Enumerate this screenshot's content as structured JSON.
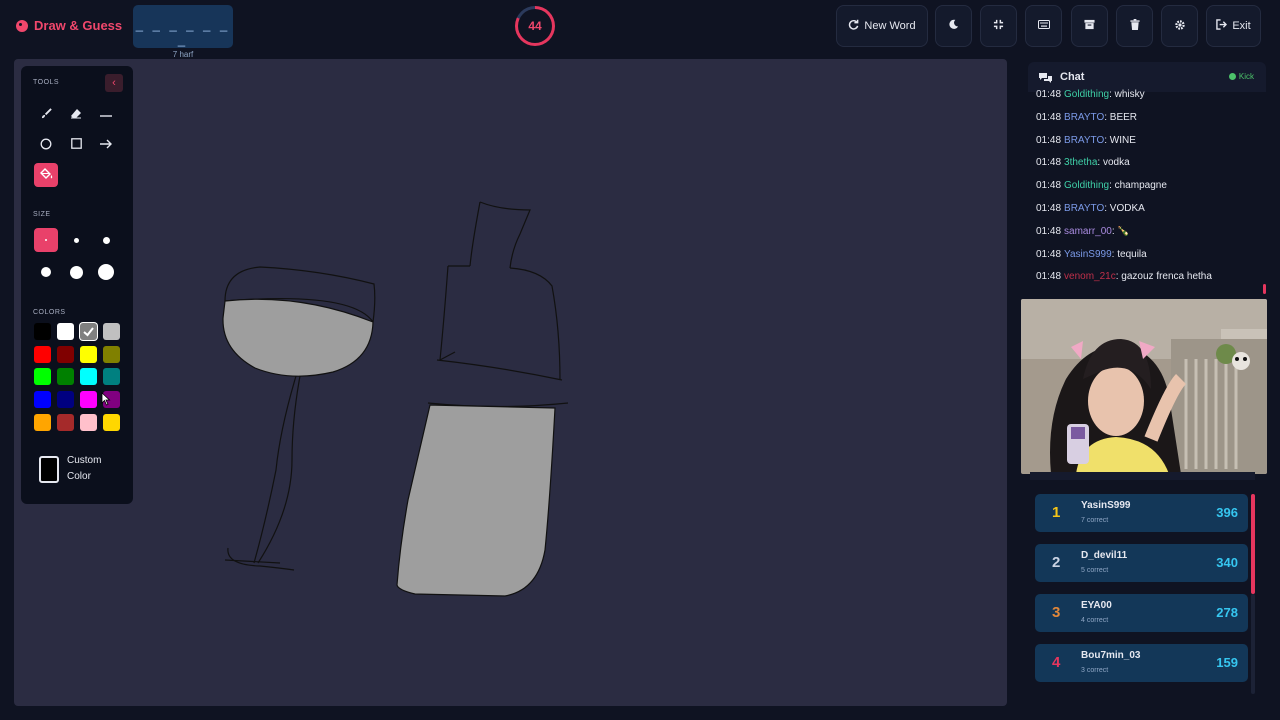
{
  "app": {
    "title": "Draw & Guess"
  },
  "word": {
    "dashes": "_ _ _ _ _ _ _",
    "hint": "7 harf"
  },
  "timer": {
    "seconds": "44",
    "progress": 0.82
  },
  "toolbar": {
    "new_word": "New Word",
    "exit": "Exit",
    "buttons": [
      "theme",
      "fullscreen",
      "keyboard",
      "archive",
      "clear",
      "settings"
    ]
  },
  "tools": {
    "title": "TOOLS",
    "items": [
      "brush",
      "eraser",
      "line",
      "circle",
      "rectangle",
      "arrow",
      "fill"
    ],
    "active": "fill",
    "size_label": "SIZE",
    "sizes": [
      2,
      4,
      6,
      8,
      10,
      12
    ],
    "active_size": 0,
    "colors_label": "COLORS",
    "colors": [
      "#000000",
      "#ffffff",
      "#808080",
      "#c0c0c0",
      "#ff0000",
      "#800000",
      "#ffff00",
      "#808000",
      "#00ff00",
      "#008000",
      "#00ffff",
      "#008080",
      "#0000ff",
      "#000080",
      "#ff00ff",
      "#800080",
      "#ffa500",
      "#a52a2a",
      "#ffc0cb",
      "#ffd700"
    ],
    "selected_color": "#808080",
    "custom_color": "Custom Color"
  },
  "canvas_actions": [
    "undo",
    "redo",
    "delete"
  ],
  "chat": {
    "title": "Chat",
    "status": "Kick",
    "messages": [
      {
        "time": "01:48",
        "user": "Goldithing",
        "text": ": whisky",
        "color": "#3fd0a8"
      },
      {
        "time": "01:48",
        "user": "BRAYTO",
        "text": ": BEER",
        "color": "#7b9ae8"
      },
      {
        "time": "01:48",
        "user": "BRAYTO",
        "text": ": WINE",
        "color": "#7b9ae8"
      },
      {
        "time": "01:48",
        "user": "3thetha",
        "text": ": vodka",
        "color": "#3fd0a8"
      },
      {
        "time": "01:48",
        "user": "Goldithing",
        "text": ": champagne",
        "color": "#3fd0a8"
      },
      {
        "time": "01:48",
        "user": "BRAYTO",
        "text": ": VODKA",
        "color": "#7b9ae8"
      },
      {
        "time": "01:48",
        "user": "samarr_00",
        "text": ": 🍾",
        "color": "#a98be0"
      },
      {
        "time": "01:48",
        "user": "YasinS999",
        "text": ": tequila",
        "color": "#7b9ae8"
      },
      {
        "time": "01:48",
        "user": "venom_21c",
        "text": ": gazouz frenca hetha",
        "color": "#c0304a"
      }
    ]
  },
  "leaderboard": {
    "rows": [
      {
        "rank": "1",
        "name": "YasinS999",
        "sub": "7 correct",
        "score": "396",
        "rank_color": "#f5c518"
      },
      {
        "rank": "2",
        "name": "D_devil11",
        "sub": "5 correct",
        "score": "340",
        "rank_color": "#c9d2e3"
      },
      {
        "rank": "3",
        "name": "EYA00",
        "sub": "4 correct",
        "score": "278",
        "rank_color": "#e0873a"
      },
      {
        "rank": "4",
        "name": "Bou7min_03",
        "sub": "3 correct",
        "score": "159",
        "rank_color": "#e6365e"
      }
    ]
  }
}
